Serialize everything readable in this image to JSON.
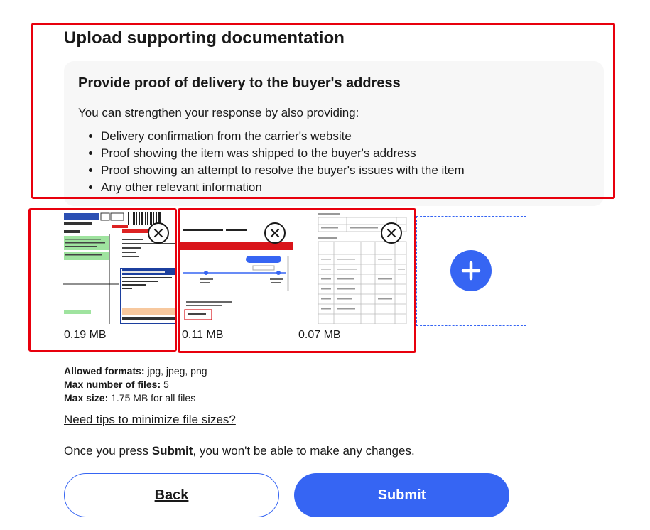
{
  "page": {
    "heading": "Upload supporting documentation",
    "info": {
      "title": "Provide proof of delivery to the buyer's address",
      "intro": "You can strengthen your response by also providing:",
      "items": [
        "Delivery confirmation from the carrier's website",
        "Proof showing the item was shipped to the buyer's address",
        "Proof showing an attempt to resolve the buyer's issues with the item",
        "Any other relevant information"
      ]
    },
    "uploads": [
      {
        "size": "0.19 MB",
        "thumb": "shipping-label-image",
        "remove_icon": "close-icon"
      },
      {
        "size": "0.11 MB",
        "thumb": "tracking-screenshot-image",
        "remove_icon": "close-icon"
      },
      {
        "size": "0.07 MB",
        "thumb": "document-table-image",
        "remove_icon": "close-icon"
      }
    ],
    "add_icon": "plus-icon",
    "requirements": {
      "formats_label": "Allowed formats:",
      "formats_value": "jpg, jpeg, png",
      "max_files_label": "Max number of files:",
      "max_files_value": "5",
      "max_size_label": "Max size:",
      "max_size_value": "1.75 MB for all files"
    },
    "tips_link": "Need tips to minimize file sizes?",
    "notice": {
      "before": "Once you press ",
      "bold": "Submit",
      "after": ", you won't be able to make any changes."
    },
    "buttons": {
      "back": "Back",
      "submit": "Submit"
    },
    "colors": {
      "accent": "#3665f3",
      "highlight": "#e8000d",
      "panel": "#f7f7f7",
      "text": "#191919"
    }
  }
}
